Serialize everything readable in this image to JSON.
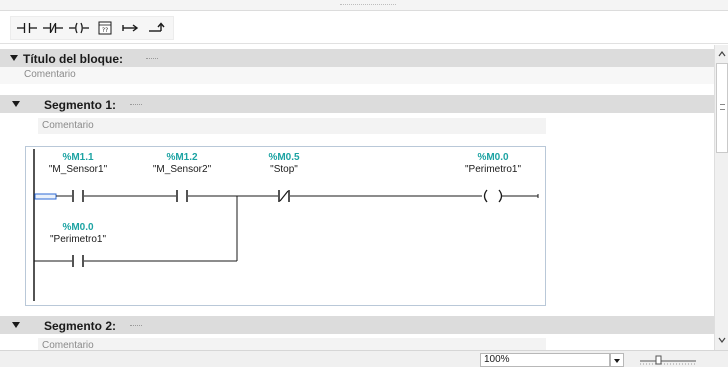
{
  "toolbar": {
    "buttons": [
      {
        "icon": "no-contact-icon"
      },
      {
        "icon": "nc-contact-icon"
      },
      {
        "icon": "coil-icon"
      },
      {
        "icon": "empty-box-icon",
        "glyph": "??"
      },
      {
        "icon": "open-branch-icon"
      },
      {
        "icon": "close-branch-icon"
      }
    ]
  },
  "block": {
    "title_label": "Título del bloque:",
    "comment": "Comentario"
  },
  "segments": [
    {
      "label": "Segmento 1:",
      "comment": "Comentario",
      "network": {
        "contacts": [
          {
            "address": "%M1.1",
            "tag": "\"M_Sensor1\"",
            "type": "NO"
          },
          {
            "address": "%M1.2",
            "tag": "\"M_Sensor2\"",
            "type": "NO"
          },
          {
            "address": "%M0.5",
            "tag": "\"Stop\"",
            "type": "NC"
          },
          {
            "address": "%M0.0",
            "tag": "\"Perimetro1\"",
            "type": "NO"
          }
        ],
        "coil": {
          "address": "%M0.0",
          "tag": "\"Perimetro1\""
        }
      }
    },
    {
      "label": "Segmento 2:",
      "comment": "Comentario"
    }
  ],
  "statusbar": {
    "zoom": "100%"
  },
  "colors": {
    "address": "#1ca3a3",
    "section_bar": "#dcdcdc",
    "network_border": "#b9c8d8",
    "rail_selection": "#2e6ad6"
  }
}
